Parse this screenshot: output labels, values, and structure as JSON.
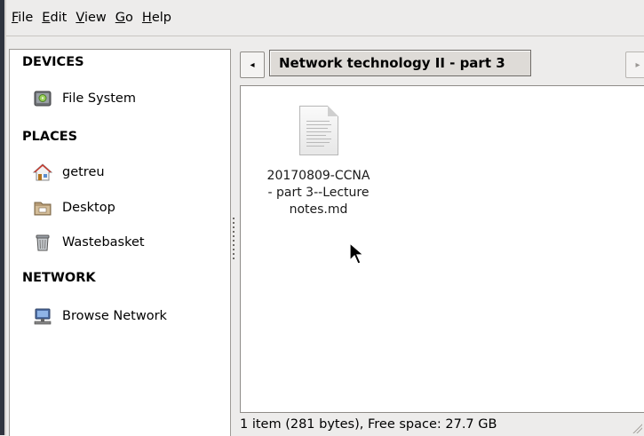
{
  "menubar": {
    "items": [
      {
        "label": "File"
      },
      {
        "label": "Edit"
      },
      {
        "label": "View"
      },
      {
        "label": "Go"
      },
      {
        "label": "Help"
      }
    ]
  },
  "sidebar": {
    "devices": {
      "heading": "DEVICES",
      "items": [
        {
          "label": "File System",
          "icon": "drive-icon"
        }
      ]
    },
    "places": {
      "heading": "PLACES",
      "items": [
        {
          "label": "getreu",
          "icon": "home-icon"
        },
        {
          "label": "Desktop",
          "icon": "desktop-folder-icon"
        },
        {
          "label": "Wastebasket",
          "icon": "trash-icon"
        }
      ]
    },
    "network": {
      "heading": "NETWORK",
      "items": [
        {
          "label": "Browse Network",
          "icon": "network-icon"
        }
      ]
    }
  },
  "pathbar": {
    "current": "Network technology II - part 3",
    "left_arrow": "◂",
    "right_arrow": "▸"
  },
  "files": [
    {
      "name": "20170809-CCNA\n- part 3--Lecture\nnotes.md",
      "icon": "text-document-icon"
    }
  ],
  "statusbar": {
    "text": "1 item (281 bytes), Free space: 27.7 GB"
  },
  "colors": {
    "window_bg": "#edeceb",
    "frame_dark": "#2f343f",
    "path_button_bg": "#dedbd7"
  }
}
